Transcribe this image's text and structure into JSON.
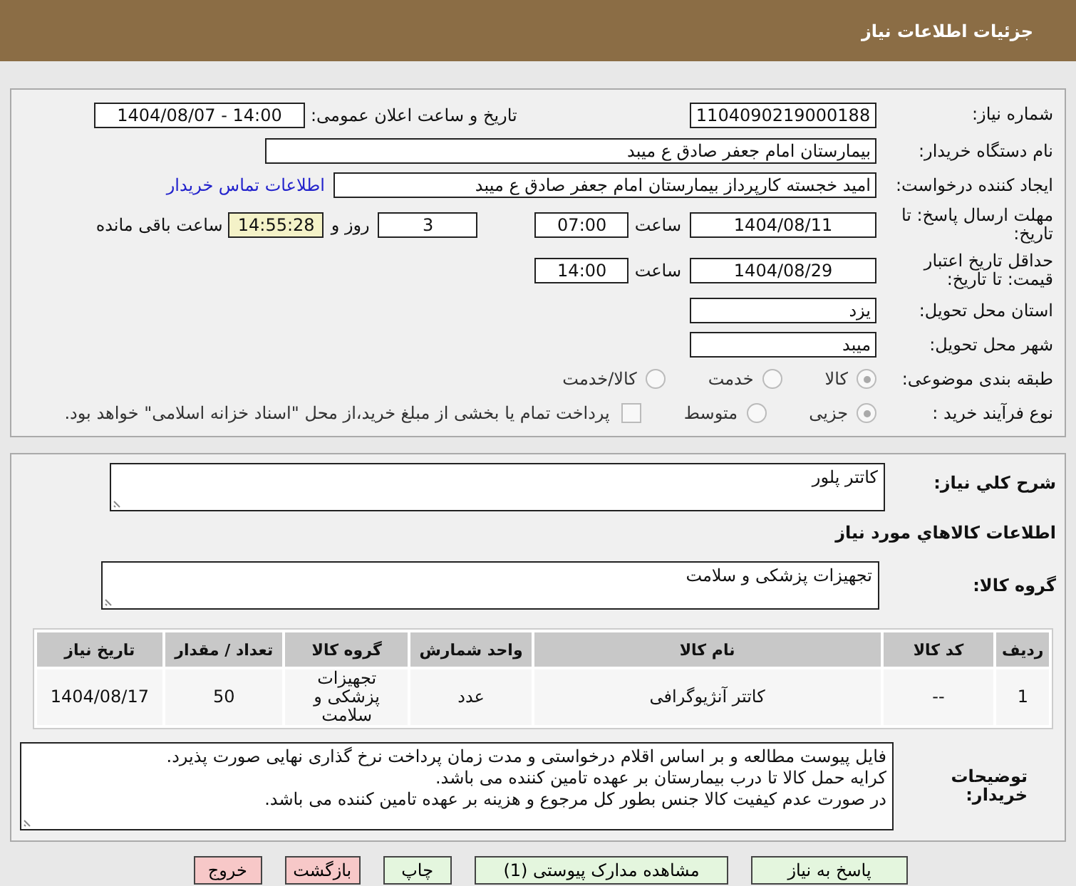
{
  "header": {
    "title": "جزئیات اطلاعات نیاز"
  },
  "need_number": {
    "label": "شماره نیاز:",
    "value": "1104090219000188"
  },
  "announce": {
    "label": "تاریخ و ساعت اعلان عمومی:",
    "value": "1404/08/07 - 14:00"
  },
  "buyer": {
    "label": "نام دستگاه خریدار:",
    "value": "بیمارستان امام جعفر صادق  ع  میبد"
  },
  "creator": {
    "label": "ایجاد کننده درخواست:",
    "value": "امید خجسته کارپرداز بیمارستان امام جعفر صادق  ع  میبد",
    "link": "اطلاعات تماس خریدار"
  },
  "deadline": {
    "label": "مهلت ارسال پاسخ: تا تاریخ:",
    "date": "1404/08/11",
    "time_label": "ساعت",
    "time": "07:00",
    "days": "3",
    "days_label": "روز و",
    "remaining": "14:55:28",
    "remaining_label": "ساعت باقی مانده"
  },
  "validity": {
    "label": "حداقل تاریخ اعتبار قیمت: تا تاریخ:",
    "date": "1404/08/29",
    "time_label": "ساعت",
    "time": "14:00"
  },
  "province": {
    "label": "استان محل تحویل:",
    "value": "یزد"
  },
  "city": {
    "label": "شهر محل تحویل:",
    "value": "میبد"
  },
  "category": {
    "label": "طبقه بندی موضوعی:",
    "options": [
      {
        "label": "کالا",
        "selected": true
      },
      {
        "label": "خدمت",
        "selected": false
      },
      {
        "label": "کالا/خدمت",
        "selected": false
      }
    ]
  },
  "process": {
    "label": "نوع فرآیند خرید :",
    "options": [
      {
        "label": "جزیی",
        "selected": true
      },
      {
        "label": "متوسط",
        "selected": false
      }
    ],
    "payment": {
      "label": "پرداخت تمام یا بخشی از مبلغ خرید،از محل \"اسناد خزانه اسلامی\" خواهد بود.",
      "checked": false
    }
  },
  "description": {
    "label": "شرح کلي نياز:",
    "value": "کاتتر پلور"
  },
  "goods_title": "اطلاعات کالاهاي مورد نياز",
  "goods_group": {
    "label": "گروه کالا:",
    "value": "تجهیزات پزشکی و سلامت"
  },
  "table": {
    "columns": [
      "ردیف",
      "کد کالا",
      "نام کالا",
      "واحد شمارش",
      "گروه کالا",
      "تعداد / مقدار",
      "تاریخ نیاز"
    ],
    "rows": [
      [
        "1",
        "--",
        "کاتتر آنژیوگرافی",
        "عدد",
        "تجهیزات پزشکی و سلامت",
        "50",
        "1404/08/17"
      ]
    ]
  },
  "notes": {
    "label": "توضیحات خریدار:",
    "lines": [
      "فایل پیوست مطالعه و بر اساس اقلام درخواستی و مدت زمان پرداخت نرخ گذاری نهایی صورت پذیرد.",
      "کرایه حمل کالا تا درب بیمارستان بر عهده تامین کننده می باشد.",
      "در صورت عدم کیفیت کالا جنس بطور کل مرجوع و هزینه بر عهده تامین کننده می باشد."
    ]
  },
  "buttons": [
    {
      "label": "پاسخ به نیاز",
      "kind": "action"
    },
    {
      "label": "مشاهده مدارک پیوستی (1)",
      "kind": "action"
    },
    {
      "label": "چاپ",
      "kind": "action"
    },
    {
      "label": "بازگشت",
      "kind": "exit"
    },
    {
      "label": "خروج",
      "kind": "exit"
    }
  ]
}
